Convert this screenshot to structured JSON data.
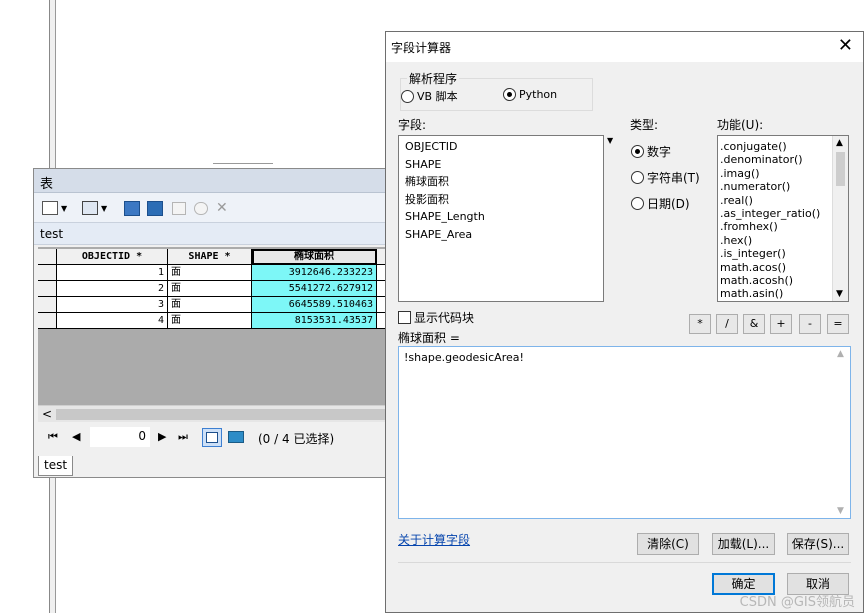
{
  "table_window": {
    "title": "表",
    "table_name": "test",
    "columns": [
      {
        "label": "OBJECTID *"
      },
      {
        "label": "SHAPE *"
      },
      {
        "label": "椭球面积"
      }
    ],
    "rows": [
      {
        "oid": "1",
        "shape": "面",
        "area": "3912646.233223"
      },
      {
        "oid": "2",
        "shape": "面",
        "area": "5541272.627912"
      },
      {
        "oid": "3",
        "shape": "面",
        "area": "6645589.510463"
      },
      {
        "oid": "4",
        "shape": "面",
        "area": "8153531.43537"
      }
    ],
    "nav": {
      "record": "0",
      "status": "(0 / 4 已选择)"
    },
    "bottom_tab": "test"
  },
  "dialog": {
    "title": "字段计算器",
    "close_glyph": "✕",
    "parser": {
      "label": "解析程序",
      "vb_label": "VB 脚本",
      "python_label": "Python",
      "selected": "Python"
    },
    "fields_label": "字段:",
    "fields": [
      "OBJECTID",
      "SHAPE",
      "椭球面积",
      "投影面积",
      "SHAPE_Length",
      "SHAPE_Area"
    ],
    "type_label": "类型:",
    "types": [
      {
        "label": "数字",
        "selected": true
      },
      {
        "label": "字符串(T)",
        "selected": false
      },
      {
        "label": "日期(D)",
        "selected": false
      }
    ],
    "functions_label": "功能(U):",
    "functions": [
      ".conjugate()",
      ".denominator()",
      ".imag()",
      ".numerator()",
      ".real()",
      ".as_integer_ratio()",
      ".fromhex()",
      ".hex()",
      ".is_integer()",
      "math.acos()",
      "math.acosh()",
      "math.asin()"
    ],
    "show_codeblock_label": "显示代码块",
    "operators": [
      "*",
      "/",
      "&",
      "+",
      "-",
      "="
    ],
    "expression_label": "椭球面积 =",
    "expression": "!shape.geodesicArea!",
    "about_link": "关于计算字段",
    "clear_button": "清除(C)",
    "load_button": "加载(L)...",
    "save_button": "保存(S)...",
    "ok_button": "确定",
    "cancel_button": "取消"
  },
  "watermark": "CSDN @GIS领航员"
}
